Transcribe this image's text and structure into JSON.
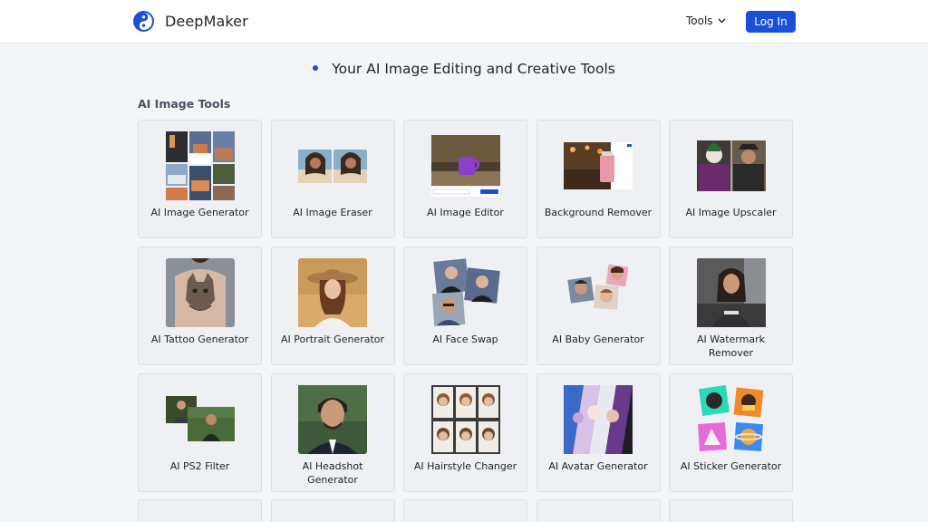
{
  "header": {
    "brand_name": "DeepMaker",
    "tools_label": "Tools",
    "login_label": "Log In"
  },
  "hero": {
    "title": "Your AI Image Editing and Creative Tools"
  },
  "section": {
    "title": "AI Image Tools"
  },
  "tools": [
    {
      "label": "AI Image Generator"
    },
    {
      "label": "AI Image Eraser"
    },
    {
      "label": "AI Image Editor"
    },
    {
      "label": "Background Remover"
    },
    {
      "label": "AI Image Upscaler"
    },
    {
      "label": "AI Tattoo Generator"
    },
    {
      "label": "AI Portrait Generator"
    },
    {
      "label": "AI Face Swap"
    },
    {
      "label": "AI Baby Generator"
    },
    {
      "label": "AI Watermark Remover"
    },
    {
      "label": "AI PS2 Filter"
    },
    {
      "label": "AI Headshot Generator"
    },
    {
      "label": "AI Hairstyle Changer"
    },
    {
      "label": "AI Avatar Generator"
    },
    {
      "label": "AI Sticker Generator"
    }
  ],
  "colors": {
    "accent": "#1a4fd8",
    "page_bg": "#f4f5f7",
    "card_bg": "#eef0f3"
  }
}
